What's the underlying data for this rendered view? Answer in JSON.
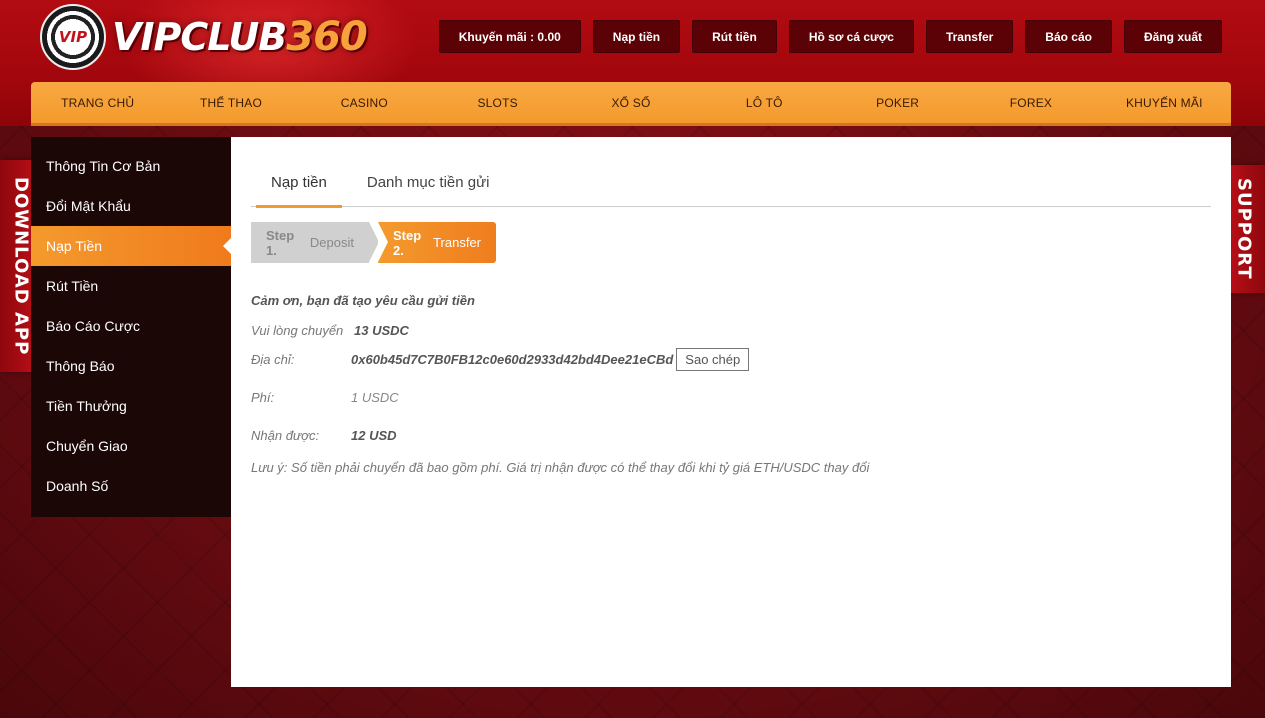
{
  "brand": {
    "logo_mark": "VIP",
    "name_a": "VIPCLUB",
    "name_b": "360"
  },
  "top_buttons": [
    {
      "label": "Khuyến mãi : 0.00"
    },
    {
      "label": "Nạp tiền"
    },
    {
      "label": "Rút tiền"
    },
    {
      "label": "Hồ sơ cá cược"
    },
    {
      "label": "Transfer"
    },
    {
      "label": "Báo cáo"
    },
    {
      "label": "Đăng xuất"
    }
  ],
  "nav": [
    {
      "label": "TRANG CHỦ"
    },
    {
      "label": "THỂ THAO"
    },
    {
      "label": "CASINO"
    },
    {
      "label": "SLOTS"
    },
    {
      "label": "XỔ SỐ"
    },
    {
      "label": "LÔ TÔ"
    },
    {
      "label": "POKER"
    },
    {
      "label": "FOREX"
    },
    {
      "label": "KHUYẾN MÃI"
    }
  ],
  "sidebar": {
    "items": [
      {
        "label": "Thông Tin Cơ Bản"
      },
      {
        "label": "Đổi Mật Khẩu"
      },
      {
        "label": "Nạp Tiền"
      },
      {
        "label": "Rút Tiền"
      },
      {
        "label": "Báo Cáo Cược"
      },
      {
        "label": "Thông Báo"
      },
      {
        "label": "Tiền Thưởng"
      },
      {
        "label": "Chuyển Giao"
      },
      {
        "label": "Doanh Số"
      }
    ],
    "active_index": 2
  },
  "side_tabs": {
    "left": "DOWNLOAD APP",
    "right": "SUPPORT"
  },
  "tabs": [
    {
      "label": "Nạp tiền"
    },
    {
      "label": "Danh mục tiền gửi"
    }
  ],
  "steps": {
    "step1": {
      "prefix": "Step 1.",
      "label": "Deposit"
    },
    "step2": {
      "prefix": "Step 2.",
      "label": "Transfer"
    }
  },
  "info": {
    "thanks": "Cảm ơn, bạn đã tạo yêu cầu gửi tiền",
    "transfer_label": "Vui lòng chuyển",
    "transfer_value": "13 USDC",
    "address_label": "Địa chỉ:",
    "address_value": "0x60b45d7C7B0FB12c0e60d2933d42bd4Dee21eCBd",
    "copy_label": "Sao chép",
    "fee_label": "Phí:",
    "fee_value": "1 USDC",
    "receive_label": "Nhận được:",
    "receive_value": "12 USD",
    "note": "Lưu ý: Số tiền phải chuyển đã bao gồm phí. Giá trị nhận được có thể thay đổi khi tỷ giá ETH/USDC thay đổi"
  },
  "colors": {
    "accent": "#f49a2d",
    "header_red": "#b30b12",
    "button_dark": "#5b0207",
    "sidebar_bg": "#1c0707"
  }
}
